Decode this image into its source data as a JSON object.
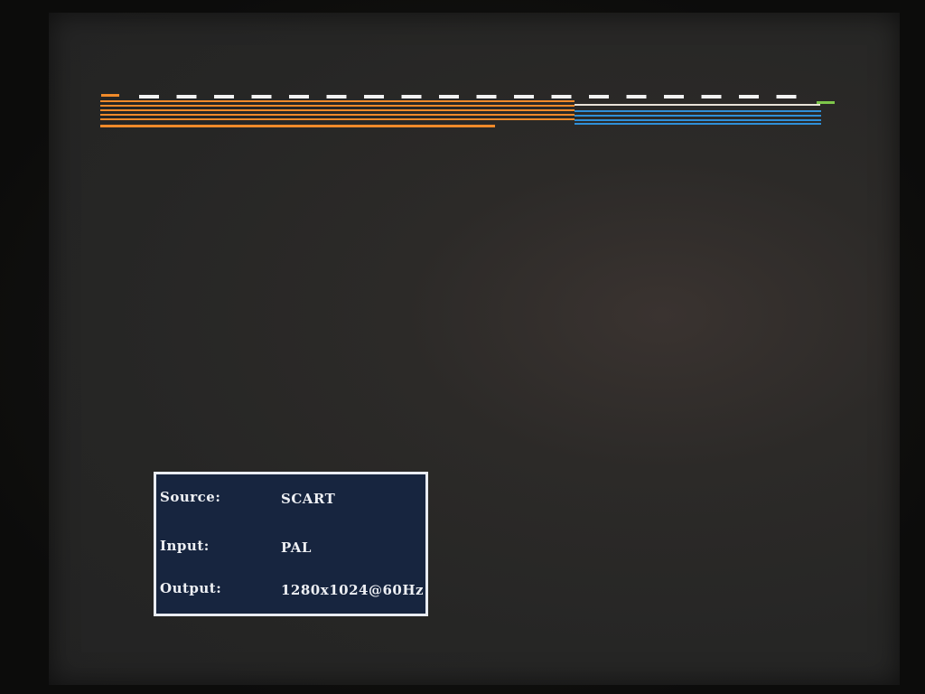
{
  "osd": {
    "source_label": "Source:",
    "source_value": "SCART",
    "input_label": "Input:",
    "input_value": "PAL",
    "output_label": "Output:",
    "output_value": "1280x1024@60Hz"
  },
  "colors": {
    "orange_stripe": "#f08a2a",
    "blue_stripe": "#2f8fd8",
    "white_dash": "#f2f2f2",
    "green_marker": "#7ec64a",
    "osd_background": "#17253f",
    "osd_border": "#e9ecf2"
  },
  "icons": {
    "stripe_pattern": "scanline-stripes"
  }
}
